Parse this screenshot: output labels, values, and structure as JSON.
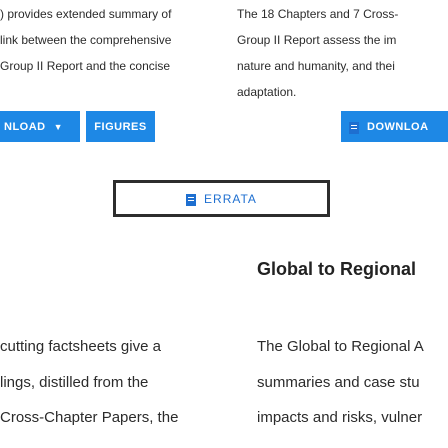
{
  "left_column": {
    "lines": [
      ") provides extended summary of",
      "link between the comprehensive",
      "Group II Report and the concise"
    ],
    "download_button": "NLOAD",
    "figures_button": "FIGURES",
    "bottom_lines": [
      "cutting factsheets give a",
      "lings, distilled from the",
      "Cross-Chapter Papers, the"
    ]
  },
  "right_column": {
    "lines": [
      "The 18 Chapters and 7 Cross-",
      "Group II Report assess the im",
      "nature and humanity, and thei",
      "adaptation."
    ],
    "download_button": "DOWNLOA",
    "heading": "Global to Regional",
    "bottom_lines": [
      "The Global to Regional A",
      "summaries and case stu",
      "impacts and risks, vulner"
    ]
  },
  "errata": {
    "label": "ERRATA"
  },
  "colors": {
    "button": "#1e88e5",
    "link": "#1e6fd0"
  },
  "icons": {
    "caret": "chevron-down-icon",
    "doc": "document-icon"
  }
}
